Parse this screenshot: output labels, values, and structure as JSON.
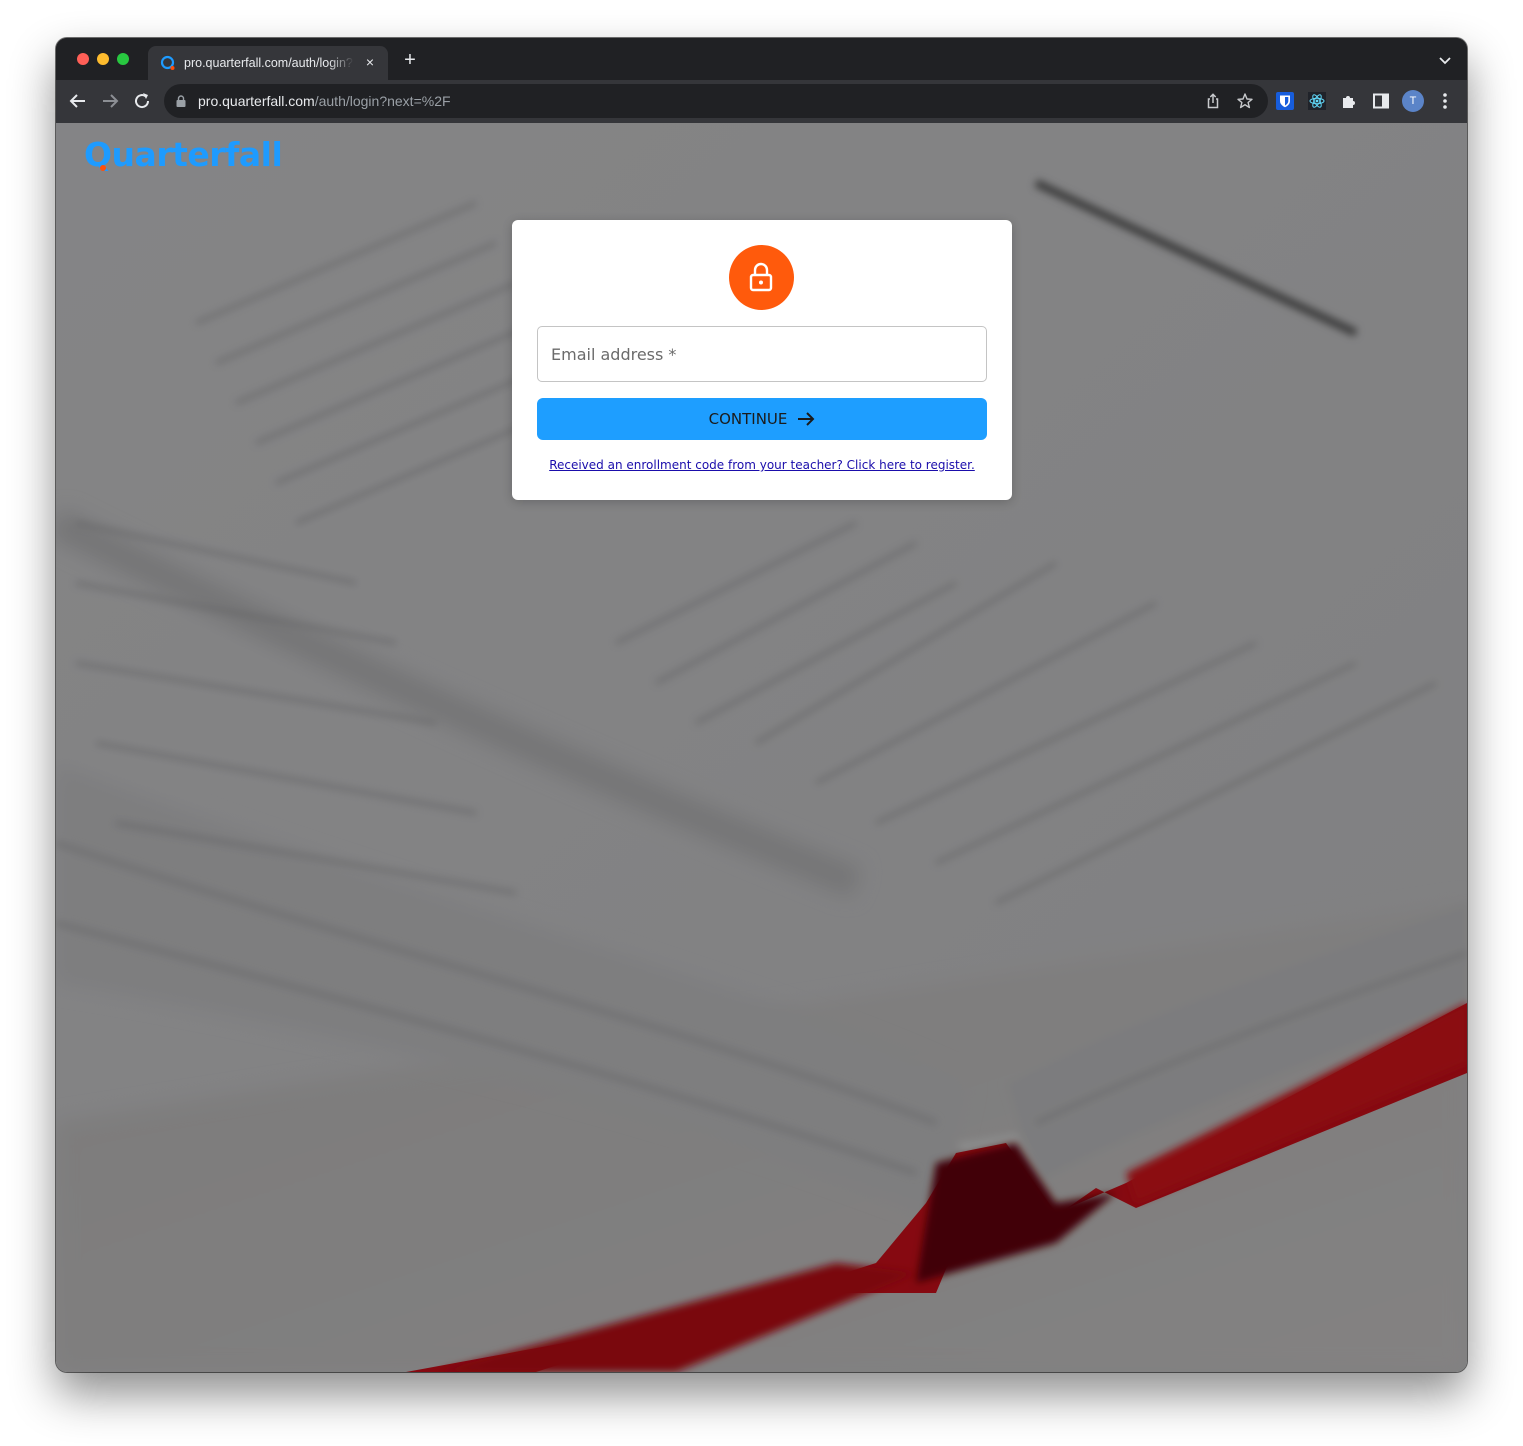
{
  "browser": {
    "tab": {
      "title": "pro.quarterfall.com/auth/login?next=%2F",
      "favicon": "quarterfall-icon",
      "close": "×"
    },
    "new_tab_label": "+",
    "url": {
      "host": "pro.quarterfall.com",
      "path": "/auth/login?next=%2F"
    },
    "profile_initial": "T",
    "toolbar_icons": [
      "back-icon",
      "forward-icon",
      "reload-icon",
      "lock-icon",
      "share-icon",
      "star-icon",
      "bitwarden-icon",
      "react-devtools-icon",
      "extensions-icon",
      "side-panel-icon",
      "profile-avatar",
      "more-menu-icon"
    ]
  },
  "page": {
    "logo": "Quarterfall",
    "brand_colors": {
      "primary": "#1e9bff",
      "accent": "#ff5a0c"
    },
    "login_card": {
      "icon": "lock-icon",
      "email_placeholder": "Email address *",
      "email_value": "",
      "continue_label": "CONTINUE",
      "continue_icon": "arrow-right-icon",
      "register_link": "Received an enrollment code from your teacher? Click here to register."
    }
  }
}
